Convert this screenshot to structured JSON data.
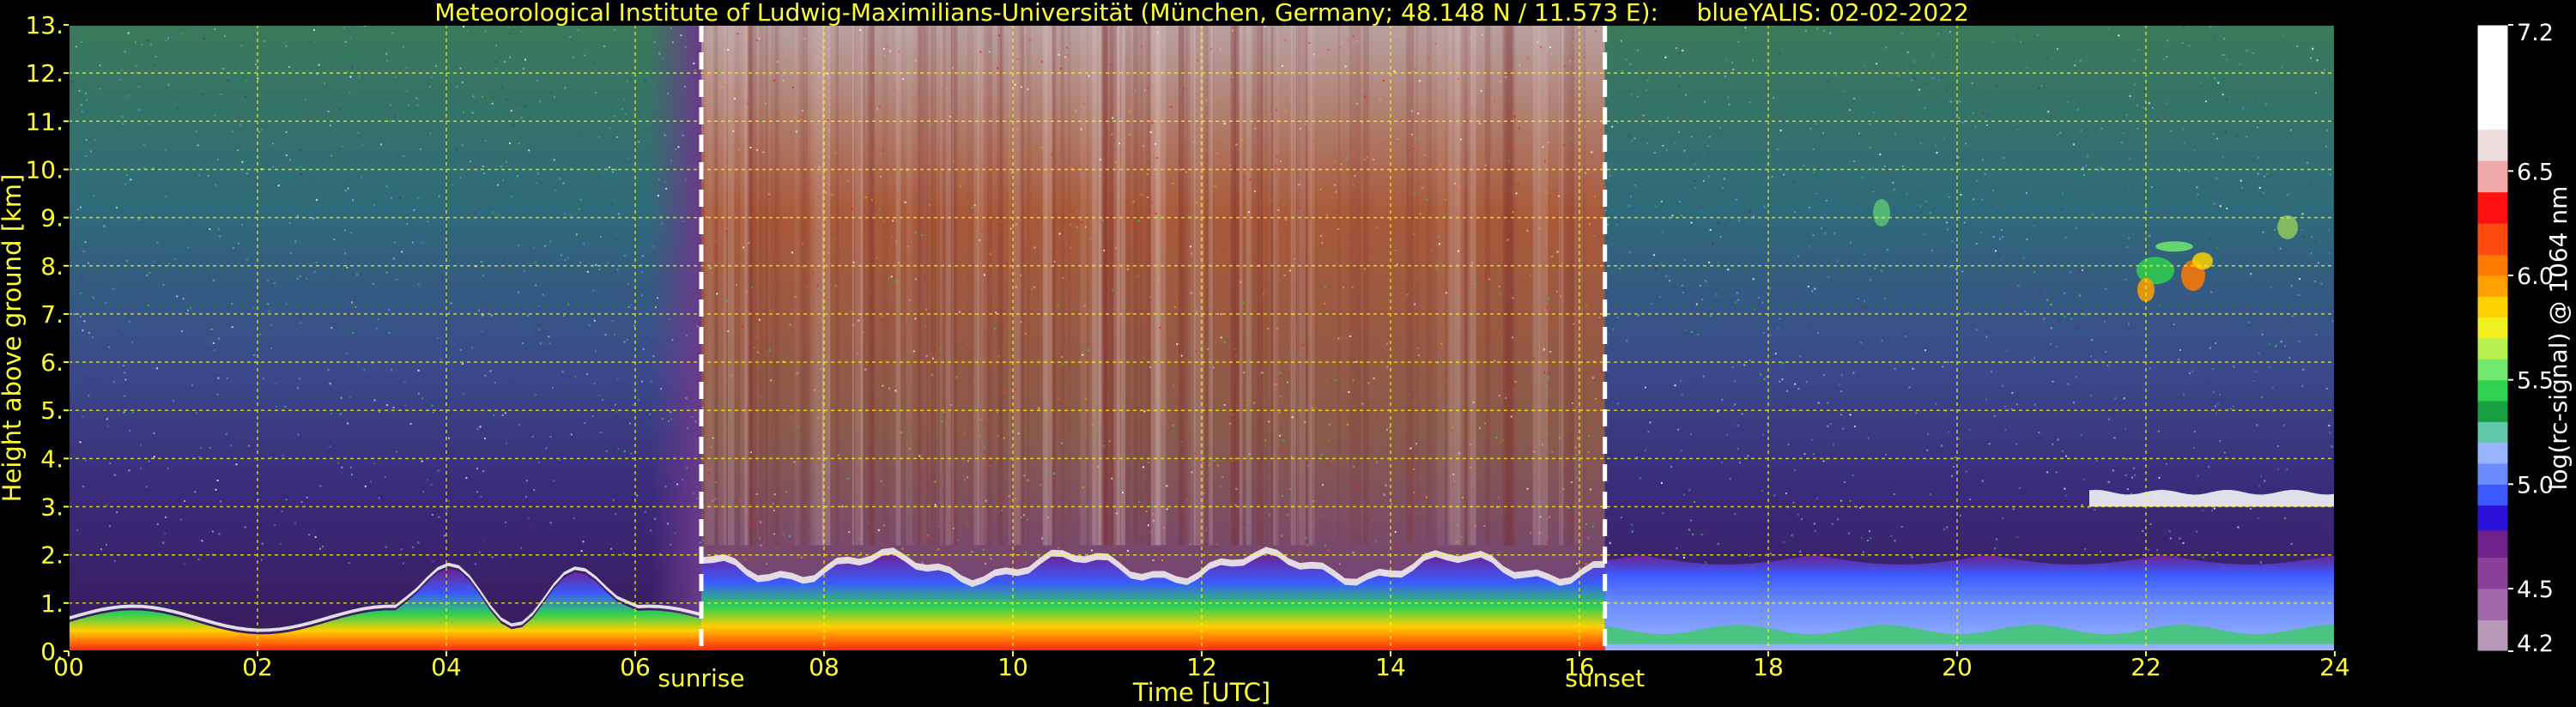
{
  "chart_data": {
    "type": "heatmap",
    "title": "Meteorological Institute of Ludwig-Maximilians-Universität (München, Germany; 48.148 N / 11.573 E):     blueYALIS: 02-02-2022",
    "xlabel": "Time [UTC]",
    "ylabel": "Height above ground [km]",
    "xlim": [
      0,
      24
    ],
    "ylim": [
      0,
      13
    ],
    "x_ticks": [
      {
        "value": 0,
        "label": "00"
      },
      {
        "value": 2,
        "label": "02"
      },
      {
        "value": 4,
        "label": "04"
      },
      {
        "value": 6,
        "label": "06"
      },
      {
        "value": 8,
        "label": "08"
      },
      {
        "value": 10,
        "label": "10"
      },
      {
        "value": 12,
        "label": "12"
      },
      {
        "value": 14,
        "label": "14"
      },
      {
        "value": 16,
        "label": "16"
      },
      {
        "value": 18,
        "label": "18"
      },
      {
        "value": 20,
        "label": "20"
      },
      {
        "value": 22,
        "label": "22"
      },
      {
        "value": 24,
        "label": "24"
      }
    ],
    "y_ticks": [
      {
        "value": 0,
        "label": "0."
      },
      {
        "value": 1,
        "label": "1."
      },
      {
        "value": 2,
        "label": "2."
      },
      {
        "value": 3,
        "label": "3."
      },
      {
        "value": 4,
        "label": "4."
      },
      {
        "value": 5,
        "label": "5."
      },
      {
        "value": 6,
        "label": "6."
      },
      {
        "value": 7,
        "label": "7."
      },
      {
        "value": 8,
        "label": "8."
      },
      {
        "value": 9,
        "label": "9."
      },
      {
        "value": 10,
        "label": "10."
      },
      {
        "value": 11,
        "label": "11."
      },
      {
        "value": 12,
        "label": "12."
      },
      {
        "value": 13,
        "label": "13."
      }
    ],
    "grid": true,
    "grid_color": "#ffff00",
    "events": [
      {
        "label": "sunrise",
        "x": 6.7
      },
      {
        "label": "sunset",
        "x": 16.27
      }
    ],
    "colorbar": {
      "label": "log(rc-signal) @ 1064 nm",
      "range": [
        4.2,
        7.2
      ],
      "ticks": [
        {
          "value": 7.2,
          "label": "7.2"
        },
        {
          "value": 6.5,
          "label": "6.5"
        },
        {
          "value": 6.0,
          "label": "6.0"
        },
        {
          "value": 5.5,
          "label": "5.5"
        },
        {
          "value": 5.0,
          "label": "5.0"
        },
        {
          "value": 4.5,
          "label": "4.5"
        },
        {
          "value": 4.2,
          "label": "4.2"
        }
      ],
      "bands": [
        {
          "from": 4.2,
          "to": 4.35,
          "color": "#b89ab8"
        },
        {
          "from": 4.35,
          "to": 4.5,
          "color": "#a06aa8"
        },
        {
          "from": 4.5,
          "to": 4.65,
          "color": "#8a3f9a"
        },
        {
          "from": 4.65,
          "to": 4.78,
          "color": "#70208a"
        },
        {
          "from": 4.78,
          "to": 4.9,
          "color": "#2a10d8"
        },
        {
          "from": 4.9,
          "to": 5.0,
          "color": "#3a5aff"
        },
        {
          "from": 5.0,
          "to": 5.1,
          "color": "#6a8cff"
        },
        {
          "from": 5.1,
          "to": 5.2,
          "color": "#9ab4ff"
        },
        {
          "from": 5.2,
          "to": 5.3,
          "color": "#60c8a8"
        },
        {
          "from": 5.3,
          "to": 5.4,
          "color": "#18a040"
        },
        {
          "from": 5.4,
          "to": 5.5,
          "color": "#30d050"
        },
        {
          "from": 5.5,
          "to": 5.6,
          "color": "#70e870"
        },
        {
          "from": 5.6,
          "to": 5.7,
          "color": "#b8f050"
        },
        {
          "from": 5.7,
          "to": 5.8,
          "color": "#f0f020"
        },
        {
          "from": 5.8,
          "to": 5.9,
          "color": "#ffd000"
        },
        {
          "from": 5.9,
          "to": 6.0,
          "color": "#ffa000"
        },
        {
          "from": 6.0,
          "to": 6.1,
          "color": "#ff7a00"
        },
        {
          "from": 6.1,
          "to": 6.25,
          "color": "#ff4a10"
        },
        {
          "from": 6.25,
          "to": 6.4,
          "color": "#ff1010"
        },
        {
          "from": 6.4,
          "to": 6.55,
          "color": "#f0a8a8"
        },
        {
          "from": 6.55,
          "to": 6.7,
          "color": "#ecdcdc"
        },
        {
          "from": 6.7,
          "to": 7.2,
          "color": "#ffffff"
        }
      ]
    },
    "features": [
      {
        "name": "night-boundary-layer",
        "x_range": [
          0,
          6.7
        ],
        "top_km": 0.6
      },
      {
        "name": "daytime-boundary-layer",
        "x_range": [
          6.7,
          16.27
        ],
        "top_km": 2.0
      },
      {
        "name": "evening-aerosol-layer",
        "x_range": [
          16.27,
          24
        ],
        "top_km": 2.0
      },
      {
        "name": "cirrus-cloud",
        "x_range": [
          21.7,
          22.6
        ],
        "bottom_km": 7.3,
        "top_km": 8.6
      },
      {
        "name": "elevated-cloud-layer",
        "x_range": [
          21.4,
          24
        ],
        "bottom_km": 3.0,
        "top_km": 3.3
      }
    ]
  }
}
